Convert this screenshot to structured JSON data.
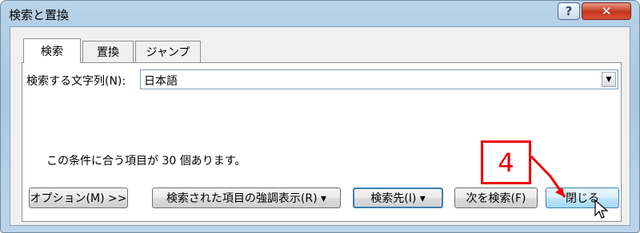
{
  "window": {
    "title": "検索と置換",
    "help_label": "?",
    "close_label": "✕"
  },
  "tabs": [
    {
      "label": "検索",
      "active": true
    },
    {
      "label": "置換",
      "active": false
    },
    {
      "label": "ジャンプ",
      "active": false
    }
  ],
  "find": {
    "label": "検索する文字列(N):",
    "value": "日本語"
  },
  "status_text": "この条件に合う項目が 30 個あります。",
  "buttons": {
    "options": "オプション(M) >>",
    "highlight": "検索された項目の強調表示(R) ▾",
    "find_in": "検索先(I) ▾",
    "find_next": "次を検索(F)",
    "close": "閉じる"
  },
  "callout": {
    "label": "4",
    "color": "#ee0000"
  },
  "colors": {
    "accent": "#3c7fb1"
  }
}
